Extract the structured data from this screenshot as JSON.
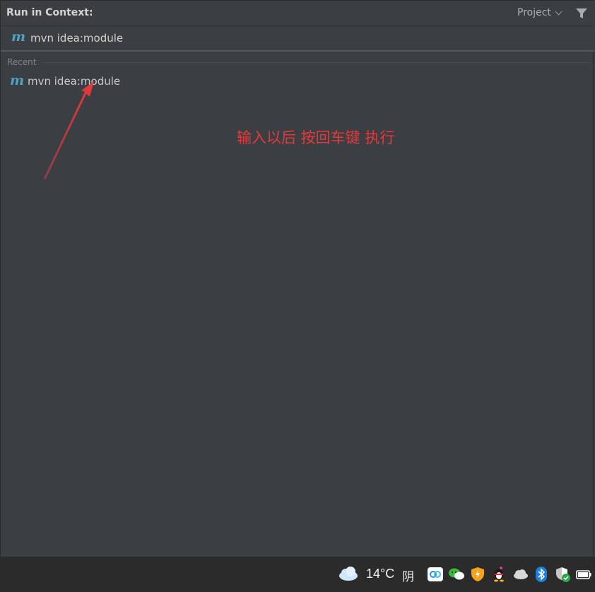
{
  "header": {
    "title": "Run in Context:",
    "scope_label": "Project",
    "filter_icon": "filter-icon"
  },
  "command": {
    "icon": "maven-icon",
    "icon_glyph": "m",
    "value": "mvn idea:module"
  },
  "recent": {
    "label": "Recent",
    "items": [
      {
        "icon": "maven-icon",
        "icon_glyph": "m",
        "label": "mvn idea:module"
      }
    ]
  },
  "annotation": {
    "text": "输入以后 按回车键 执行",
    "color": "#e6393b"
  },
  "taskbar": {
    "temperature": "14°C",
    "weather_condition": "阴",
    "icons": [
      "cloud-weather-icon",
      "baidu-netdisk-icon",
      "wechat-icon",
      "security-shield-icon",
      "qq-icon",
      "onedrive-icon",
      "bluetooth-icon",
      "windows-security-icon",
      "battery-icon"
    ]
  },
  "colors": {
    "panel_bg": "#3b3e42",
    "accent_maven": "#4fa3c9",
    "annotation_red": "#e6393b",
    "taskbar_bg": "#2b2b2b"
  }
}
